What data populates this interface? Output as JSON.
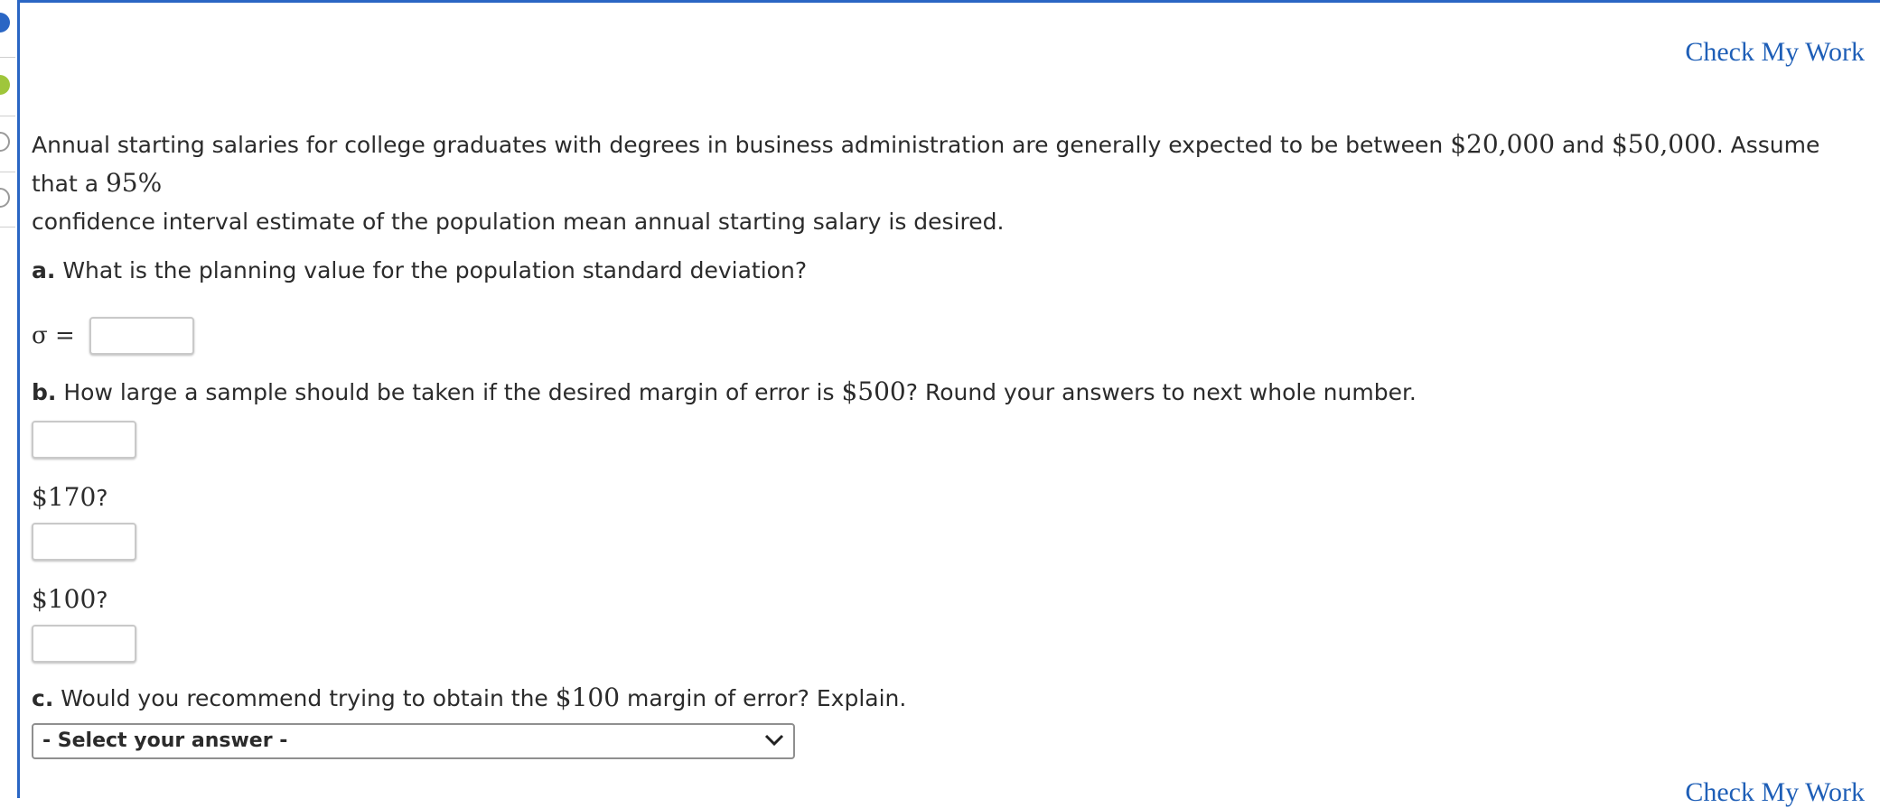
{
  "header": {
    "check_my_work": "Check My Work"
  },
  "problem": {
    "intro_1": "Annual starting salaries for college graduates with degrees in business administration are generally expected to be between ",
    "low_salary": "$20,000",
    "intro_2": " and ",
    "high_salary": "$50,000",
    "intro_3": ". Assume that a ",
    "confidence": "95%",
    "intro_4": "confidence interval estimate of the population mean annual starting salary is desired."
  },
  "part_a": {
    "label": "a.",
    "question": " What is the planning value for the population standard deviation?",
    "sigma_label": "σ =",
    "answer_value": ""
  },
  "part_b": {
    "label": "b.",
    "question_1": " How large a sample should be taken if the desired margin of error is ",
    "margin_1": "$500",
    "question_2": "? Round your answers to next whole number.",
    "answer_500": "",
    "margin_2": "$170",
    "answer_170": "",
    "margin_3": "$100",
    "answer_100": "",
    "q_mark": "?"
  },
  "part_c": {
    "label": "c.",
    "question_1": " Would you recommend trying to obtain the ",
    "margin": "$100",
    "question_2": " margin of error? Explain.",
    "select_value": "- Select your answer -"
  },
  "footer": {
    "check_my_work": "Check My Work"
  },
  "colors": {
    "accent": "#2a66c4",
    "link": "#1f5fb7"
  }
}
